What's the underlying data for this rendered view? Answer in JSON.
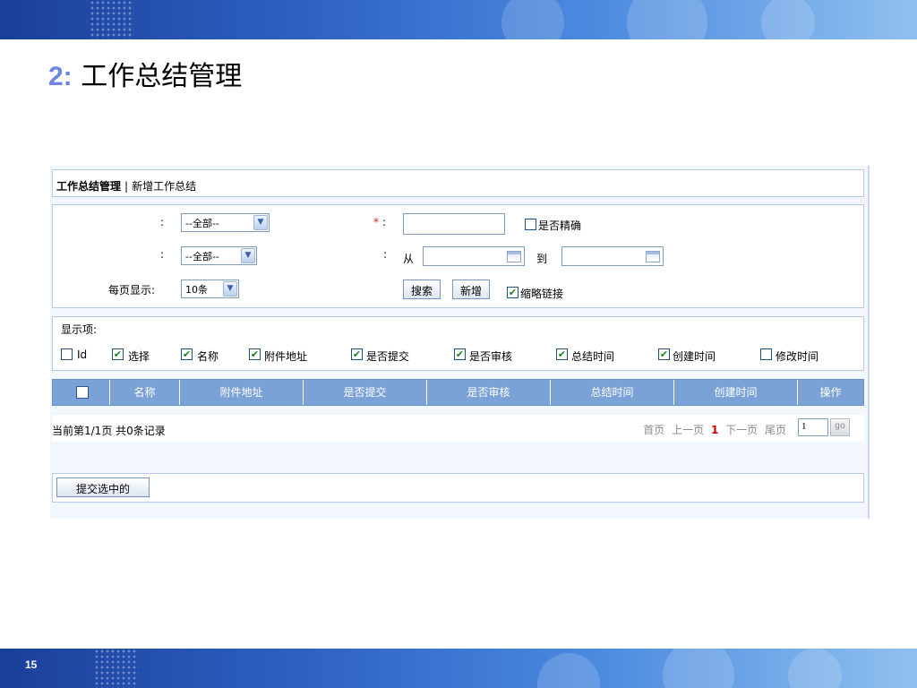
{
  "slide": {
    "title_number": "2:",
    "title_text": "工作总结管理",
    "page_number": "15"
  },
  "breadcrumb": {
    "current": "工作总结管理",
    "separator": "|",
    "link": "新增工作总结"
  },
  "search": {
    "field1_label": ":",
    "field1_value": "--全部--",
    "field2_label": ":",
    "field2_value": "--全部--",
    "page_size_label": "每页显示:",
    "page_size_value": "10条",
    "required_mark": "*",
    "text_field_label": ":",
    "exact_match_label": "是否精确",
    "date_label": ":",
    "date_from_label": "从",
    "date_to_label": "到",
    "search_button": "搜索",
    "add_button": "新增",
    "abbr_link_label": "缩略链接"
  },
  "display_items": {
    "title": "显示项:",
    "options": [
      {
        "label": "Id",
        "checked": false
      },
      {
        "label": "选择",
        "checked": true
      },
      {
        "label": "名称",
        "checked": true
      },
      {
        "label": "附件地址",
        "checked": true
      },
      {
        "label": "是否提交",
        "checked": true
      },
      {
        "label": "是否审核",
        "checked": true
      },
      {
        "label": "总结时间",
        "checked": true
      },
      {
        "label": "创建时间",
        "checked": true
      },
      {
        "label": "修改时间",
        "checked": false
      }
    ]
  },
  "table": {
    "columns": [
      "名称",
      "附件地址",
      "是否提交",
      "是否审核",
      "总结时间",
      "创建时间",
      "操作"
    ]
  },
  "pager": {
    "summary": "当前第1/1页 共0条记录",
    "first": "首页",
    "prev": "上一页",
    "current": "1",
    "next": "下一页",
    "last": "尾页",
    "goto_value": "1",
    "go_label": "go"
  },
  "submit": {
    "button_label": "提交选中的"
  },
  "colors": {
    "header_blue": "#7aa2d6",
    "slide_bar": "#2f63c4",
    "title_number": "#6b86e0",
    "current_page": "#d10000"
  }
}
